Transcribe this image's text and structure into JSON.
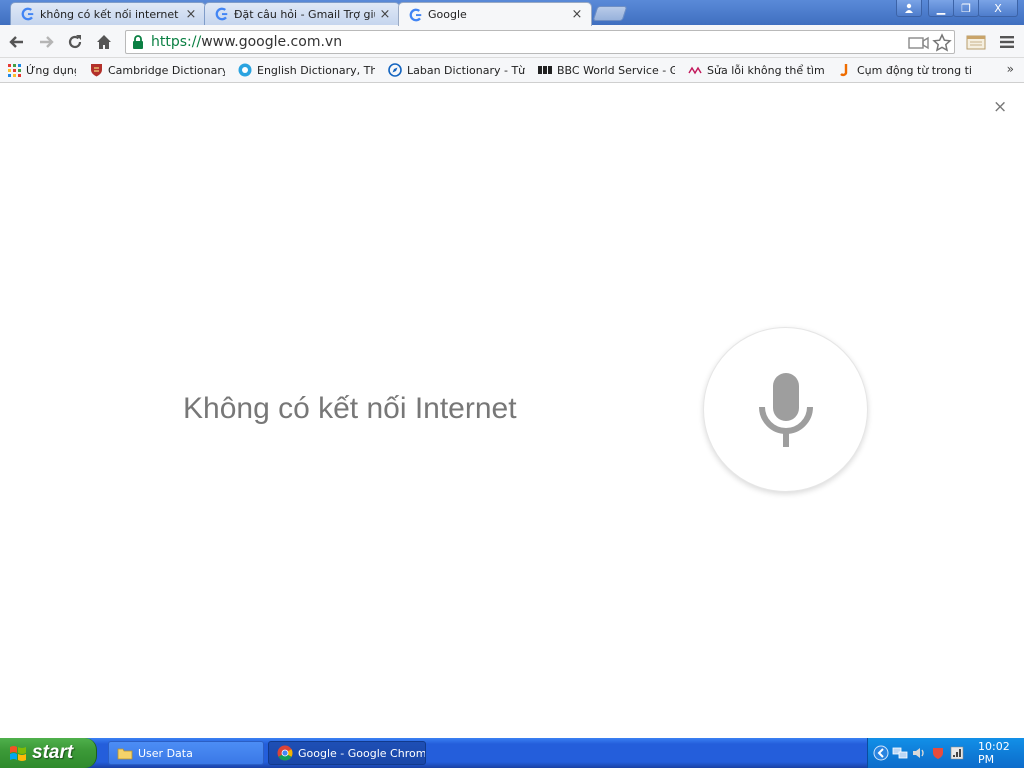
{
  "browser": {
    "tabs": [
      {
        "title": "không có kết nối internet khi",
        "active": false
      },
      {
        "title": "Đặt câu hỏi - Gmail Trợ giúp",
        "active": false
      },
      {
        "title": "Google",
        "active": true
      }
    ],
    "tab_close_glyph": "×",
    "window_controls": {
      "minimize": "▁",
      "restore": "❐",
      "close": "X"
    },
    "url": {
      "scheme": "https://",
      "host": "www.google.com.vn"
    },
    "bookmarks": [
      {
        "label": "Ứng dụng",
        "icon": "apps-grid-icon"
      },
      {
        "label": "Cambridge Dictionary | E",
        "icon": "cambridge-shield-icon"
      },
      {
        "label": "English Dictionary, Thes",
        "icon": "dictionary-circle-icon"
      },
      {
        "label": "Laban Dictionary - Từ đi",
        "icon": "compass-icon"
      },
      {
        "label": "BBC World Service - Glob",
        "icon": "bbc-icon"
      },
      {
        "label": "Sửa lỗi không thể tìm thấ",
        "icon": "site-icon"
      },
      {
        "label": "Cụm động từ trong tiếng",
        "icon": "j-icon"
      }
    ],
    "bookmarks_more_glyph": "»"
  },
  "page": {
    "message": "Không có kết nối Internet",
    "close_glyph": "×"
  },
  "taskbar": {
    "start_label": "start",
    "tasks": [
      {
        "label": "User Data",
        "icon": "folder-icon",
        "active": false
      },
      {
        "label": "Google - Google Chrome",
        "icon": "chrome-icon",
        "active": true
      }
    ],
    "clock": "10:02 PM"
  },
  "colors": {
    "accent_blue": "#245edb",
    "start_green": "#3c9a38",
    "mic_gray": "#9e9e9e",
    "message_gray": "#777777",
    "secure_green": "#0b8043"
  }
}
